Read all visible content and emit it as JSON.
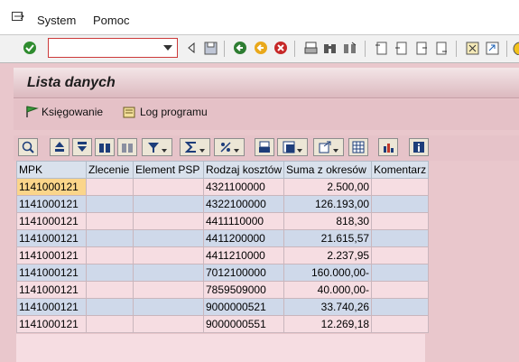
{
  "menu": {
    "items": [
      "System",
      "Pomoc"
    ]
  },
  "toolbar": {
    "command_value": ""
  },
  "title": "Lista danych",
  "app_toolbar": {
    "booking_label": "Księgowanie",
    "log_label": "Log programu"
  },
  "grid": {
    "columns": [
      "MPK",
      "Zlecenie",
      "Element PSP",
      "Rodzaj kosztów",
      "Suma z okresów",
      "Komentarz"
    ],
    "rows": [
      [
        "1141000121",
        "",
        "",
        "4321100000",
        "2.500,00",
        ""
      ],
      [
        "1141000121",
        "",
        "",
        "4322100000",
        "126.193,00",
        ""
      ],
      [
        "1141000121",
        "",
        "",
        "4411110000",
        "818,30",
        ""
      ],
      [
        "1141000121",
        "",
        "",
        "4411200000",
        "21.615,57",
        ""
      ],
      [
        "1141000121",
        "",
        "",
        "4411210000",
        "2.237,95",
        ""
      ],
      [
        "1141000121",
        "",
        "",
        "7012100000",
        "160.000,00-",
        ""
      ],
      [
        "1141000121",
        "",
        "",
        "7859509000",
        "40.000,00-",
        ""
      ],
      [
        "1141000121",
        "",
        "",
        "9000000521",
        "33.740,26",
        ""
      ],
      [
        "1141000121",
        "",
        "",
        "9000000551",
        "12.269,18",
        ""
      ]
    ]
  },
  "colors": {
    "selected_cell": "#fbd58a",
    "row_even": "#cfd9ea",
    "row_odd": "#f6dde2",
    "background": "#e9c7cc"
  }
}
